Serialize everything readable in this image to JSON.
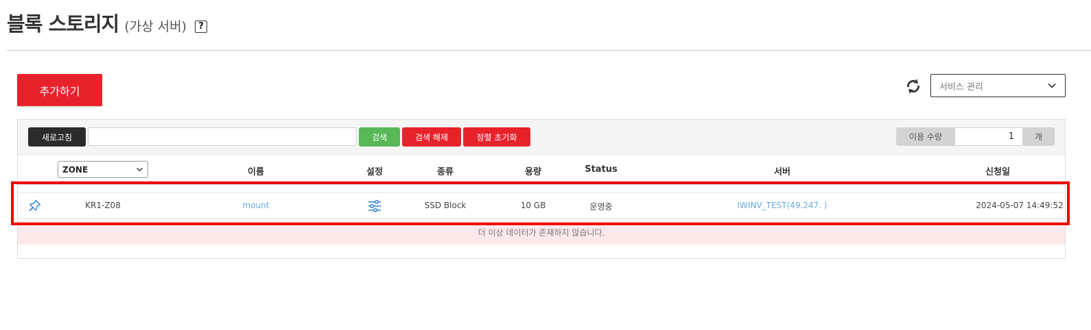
{
  "header": {
    "title": "블록 스토리지",
    "subtitle": "(가상 서버)",
    "help": "?"
  },
  "actions": {
    "add_label": "추가하기",
    "service_select": "서비스 관리"
  },
  "toolbar": {
    "refresh_label": "새로고침",
    "search_placeholder": "",
    "search_label": "검색",
    "clear_label": "검색 해제",
    "reset_sort_label": "정렬 초기화",
    "usage_label": "이용 수량",
    "usage_value": "1",
    "usage_unit": "개"
  },
  "table": {
    "zone_filter": "ZONE",
    "columns": {
      "name": "이름",
      "settings": "설정",
      "type": "종류",
      "capacity": "용량",
      "status": "Status",
      "server": "서버",
      "date": "신청일"
    },
    "rows": [
      {
        "zone": "KR1-Z08",
        "name": "mount",
        "type": "SSD Block",
        "capacity": "10 GB",
        "status": "운영중",
        "server": "IWINV_TEST(49.247.            )",
        "date": "2024-05-07 14:49:52"
      }
    ],
    "empty_message": "더 이상 데이터가 존재하지 않습니다."
  },
  "colors": {
    "primary_red": "#e8222b",
    "search_green": "#58b857",
    "link_blue": "#6aa8e0",
    "highlight": "#f00000"
  }
}
